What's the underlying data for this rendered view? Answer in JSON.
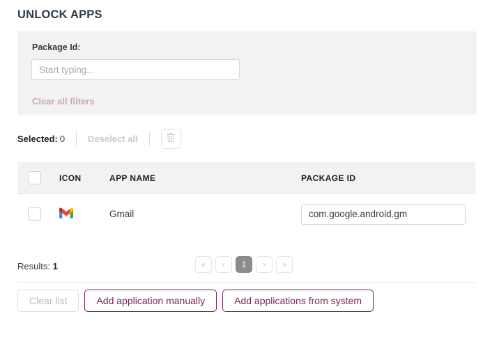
{
  "header": {
    "title": "UNLOCK APPS"
  },
  "filter_panel": {
    "package_id_label": "Package Id:",
    "package_id_value": "",
    "package_id_placeholder": "Start typing...",
    "clear_filters_label": "Clear all filters",
    "clear_filters_color": "#cba8bd",
    "background": "#f2f2f2"
  },
  "toolbar": {
    "selected_label": "Selected:",
    "selected_count": "0",
    "deselect_all_label": "Deselect all",
    "delete_icon": "trash-icon"
  },
  "table": {
    "columns": [
      {
        "key": "check",
        "label": ""
      },
      {
        "key": "icon",
        "label": "ICON"
      },
      {
        "key": "name",
        "label": "APP NAME"
      },
      {
        "key": "package",
        "label": "PACKAGE ID"
      }
    ],
    "header_background": "#f2f2f2",
    "rows": [
      {
        "icon": "gmail-icon",
        "app_name": "Gmail",
        "package_id": "com.google.android.gm",
        "checked": false
      }
    ]
  },
  "results": {
    "label": "Results:",
    "count": "1"
  },
  "pagination": {
    "first_label": "«",
    "prev_label": "‹",
    "current_page": "1",
    "next_label": "›",
    "last_label": "»",
    "active_background": "#8d8a8d"
  },
  "footer": {
    "clear_list_label": "Clear list",
    "add_manually_label": "Add application manually",
    "add_from_system_label": "Add applications from system",
    "accent_color": "#7d1f58"
  },
  "gmail_colors": {
    "red": "#EA4335",
    "blue": "#4285F4",
    "yellow": "#FBBC04",
    "green": "#34A853",
    "white": "#FFFFFF"
  }
}
